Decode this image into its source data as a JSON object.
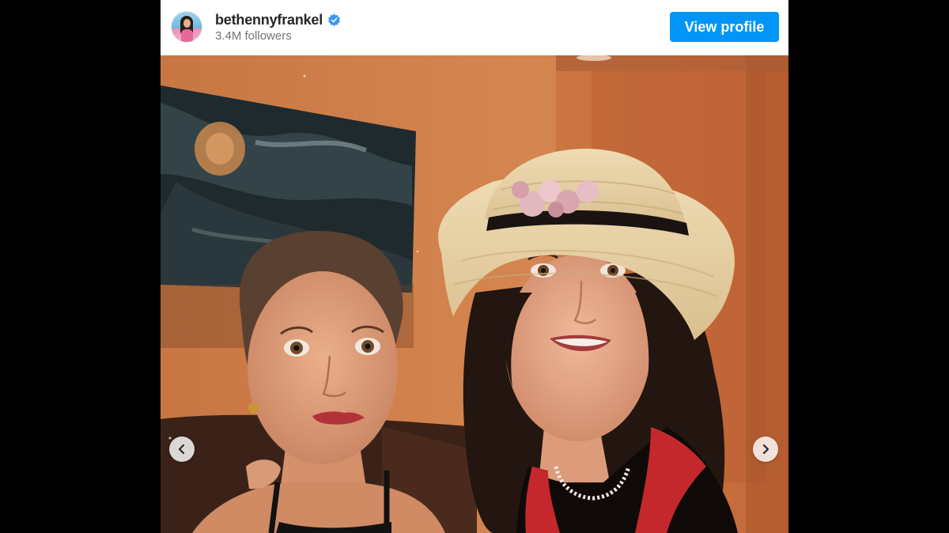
{
  "post": {
    "username": "bethennyfrankel",
    "followers": "3.4M followers",
    "view_profile_label": "View profile",
    "verified": true
  },
  "icons": {
    "verified": "verified-badge-icon",
    "prev": "chevron-left-icon",
    "next": "chevron-right-icon"
  },
  "colors": {
    "button_bg": "#0095f6",
    "verified_blue": "#3897f0",
    "page_background": "#000000"
  },
  "carousel": {
    "has_previous": true,
    "has_next": true
  }
}
